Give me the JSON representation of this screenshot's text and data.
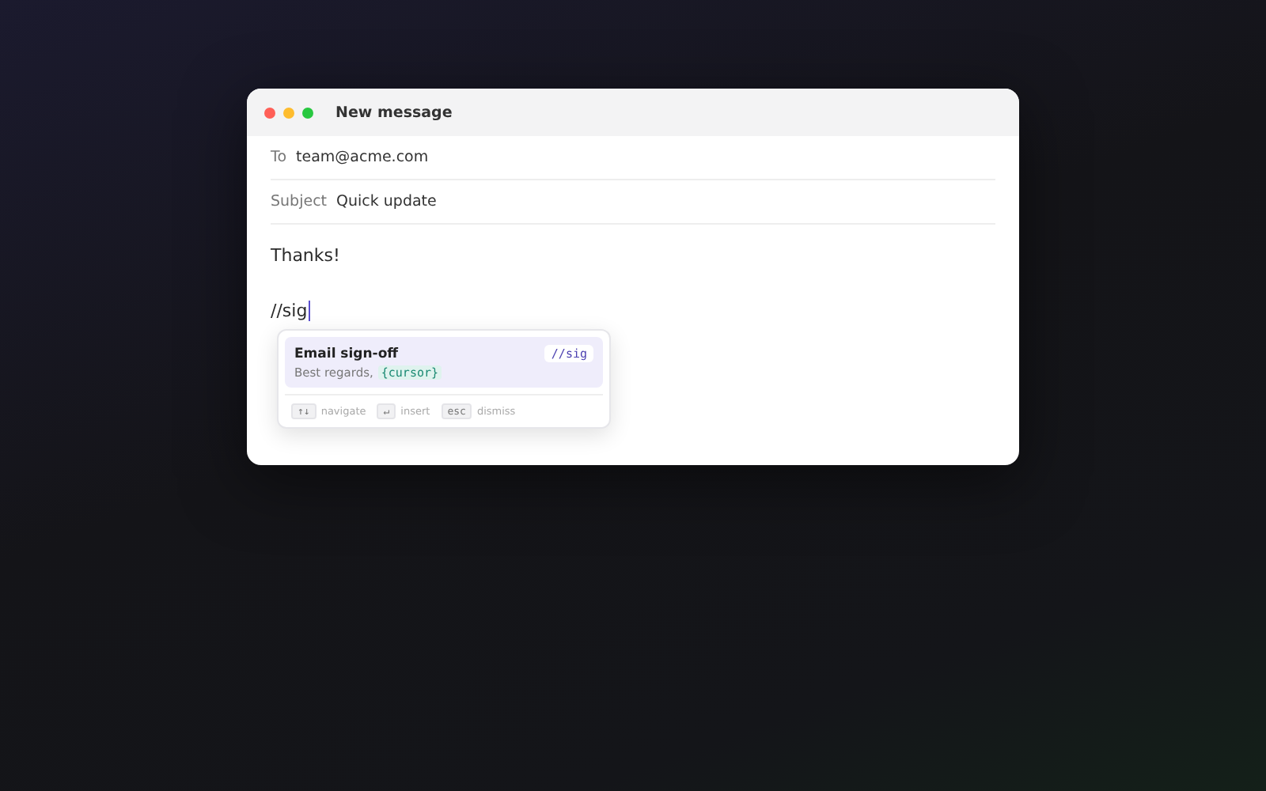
{
  "window": {
    "title": "New message"
  },
  "fields": [
    {
      "label": "To",
      "value": "team@acme.com"
    },
    {
      "label": "Subject",
      "value": "Quick update"
    }
  ],
  "body": {
    "lines": [
      "Thanks!"
    ],
    "typed": "//sig"
  },
  "suggestions": [
    {
      "title": "Email sign-off",
      "trigger": "//sig",
      "preview": "Best regards,",
      "token": "{cursor}",
      "selected": true
    }
  ],
  "hints": [
    {
      "key": "↑↓",
      "label": "navigate"
    },
    {
      "key": "↵",
      "label": "insert"
    },
    {
      "key": "esc",
      "label": "dismiss"
    }
  ]
}
